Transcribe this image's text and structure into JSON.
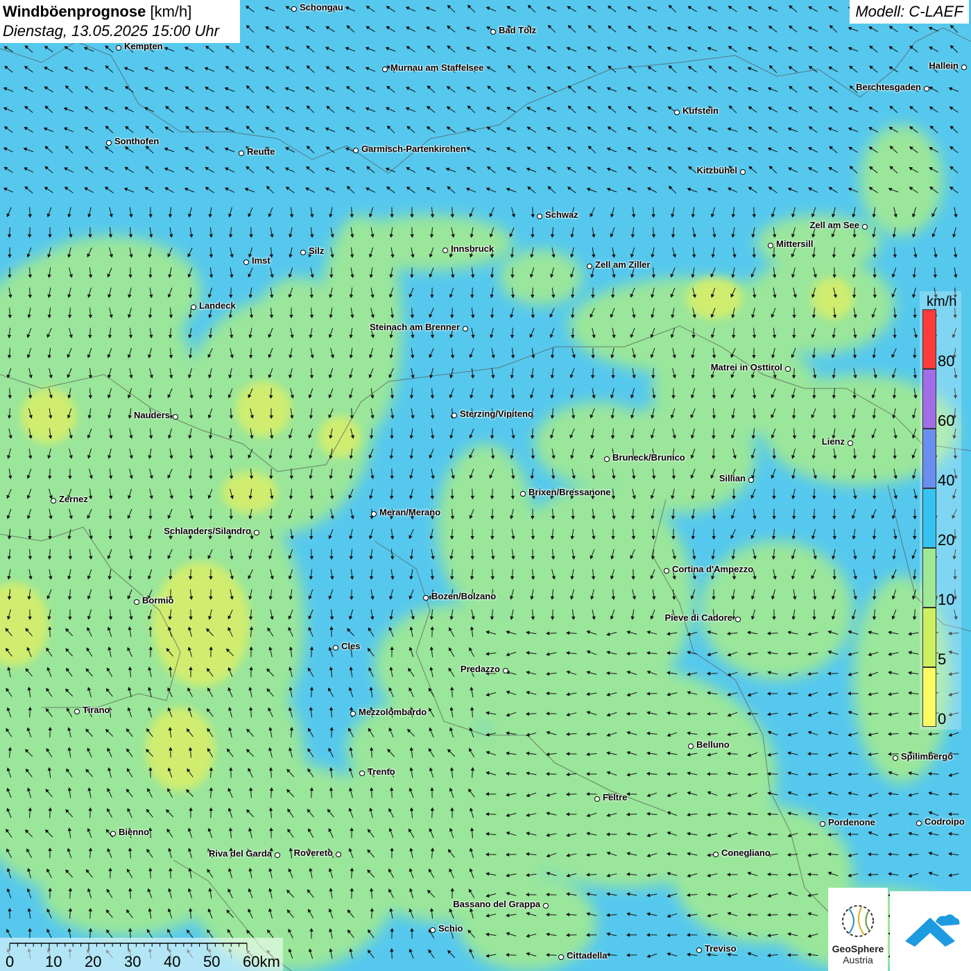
{
  "header": {
    "title": "Windböenprognose",
    "unit": "[km/h]",
    "datetime": "Dienstag, 13.05.2025 15:00 Uhr",
    "model": "Modell: C-LAEF"
  },
  "colors": {
    "base_blue": "#56c8ee",
    "green": "#9ee896",
    "yellow_green": "#d4ee6a",
    "arrow": "#111111"
  },
  "legend": {
    "unit": "km/h",
    "bands": [
      {
        "color": "#ff3a3a",
        "label": "80"
      },
      {
        "color": "#a26ee8",
        "label": "60"
      },
      {
        "color": "#6a8ff0",
        "label": "40"
      },
      {
        "color": "#35c4f2",
        "label": "20"
      },
      {
        "color": "#9ee896",
        "label": "10"
      },
      {
        "color": "#cdf060",
        "label": "5"
      },
      {
        "color": "#fbfb63",
        "label": "0"
      }
    ]
  },
  "scalebar": {
    "labels": [
      "0",
      "10",
      "20",
      "30",
      "40",
      "50",
      "60km"
    ]
  },
  "cities": [
    {
      "name": "Schongau"
    },
    {
      "name": "Bad Tölz"
    },
    {
      "name": "Kempten"
    },
    {
      "name": "Hallein"
    },
    {
      "name": "Murnau am Staffelsee"
    },
    {
      "name": "Berchtesgaden"
    },
    {
      "name": "Kufstein"
    },
    {
      "name": "Sonthofen"
    },
    {
      "name": "Reutte"
    },
    {
      "name": "Garmisch-Partenkirchen"
    },
    {
      "name": "Kitzbühel"
    },
    {
      "name": "Schwaz"
    },
    {
      "name": "Zell am See"
    },
    {
      "name": "Innsbruck"
    },
    {
      "name": "Silz"
    },
    {
      "name": "Mittersill"
    },
    {
      "name": "Imst"
    },
    {
      "name": "Zell am Ziller"
    },
    {
      "name": "Landeck"
    },
    {
      "name": "Steinach am Brenner"
    },
    {
      "name": "Matrei in Osttirol"
    },
    {
      "name": "Nauders"
    },
    {
      "name": "Sterzing/Vipiteno"
    },
    {
      "name": "Lienz"
    },
    {
      "name": "Bruneck/Brunico"
    },
    {
      "name": "Sillian"
    },
    {
      "name": "Brixen/Bressanone"
    },
    {
      "name": "Zernez"
    },
    {
      "name": "Meran/Merano"
    },
    {
      "name": "Schlanders/Silandro"
    },
    {
      "name": "Cortina d'Ampezzo"
    },
    {
      "name": "Bozen/Bolzano"
    },
    {
      "name": "Bormio"
    },
    {
      "name": "Pieve di Cadore"
    },
    {
      "name": "Cles"
    },
    {
      "name": "Predazzo"
    },
    {
      "name": "Tirano"
    },
    {
      "name": "Mezzolombardo"
    },
    {
      "name": "Belluno"
    },
    {
      "name": "Spilimbergo"
    },
    {
      "name": "Trento"
    },
    {
      "name": "Feltre"
    },
    {
      "name": "Pordenone"
    },
    {
      "name": "Codroipo"
    },
    {
      "name": "Bienno"
    },
    {
      "name": "Riva del Garda"
    },
    {
      "name": "Rovereto"
    },
    {
      "name": "Conegliano"
    },
    {
      "name": "Bassano del Grappa"
    },
    {
      "name": "Schio"
    },
    {
      "name": "Treviso"
    },
    {
      "name": "Cittadella"
    }
  ],
  "logos": {
    "geosphere_line1": "GeoSphere",
    "geosphere_line2": "Austria"
  }
}
